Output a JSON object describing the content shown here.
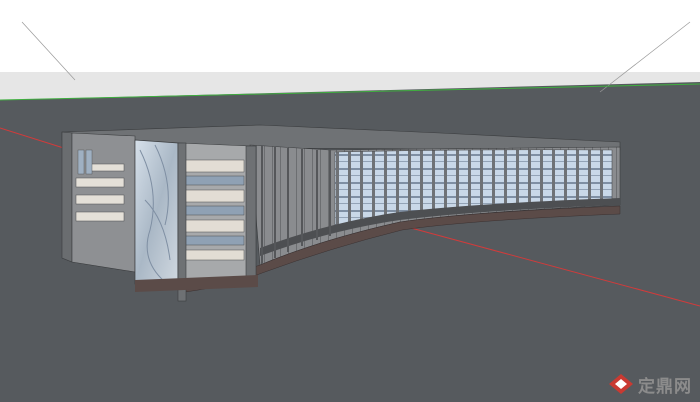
{
  "scene": {
    "description_type": "sketchup-3d-render",
    "colors": {
      "sky": "#ffffff",
      "horizon_band": "#e8e8e8",
      "ground": "#565a5e",
      "green_axis": "#3fae3f",
      "red_axis": "#d13b3b",
      "wall_dark": "#7d8083",
      "wall_mid": "#9a9c9e",
      "wall_light": "#b9babb",
      "glass": "#c9d8e8",
      "glass_dark": "#7f8fa3",
      "base_band": "#5b4b48",
      "floor_slab": "#d9d4cb"
    }
  },
  "watermark": {
    "text": "定鼎网",
    "logo_icon": "red-diamond-logo",
    "color": "#8c8c8c",
    "logo_color": "#c93a32"
  }
}
